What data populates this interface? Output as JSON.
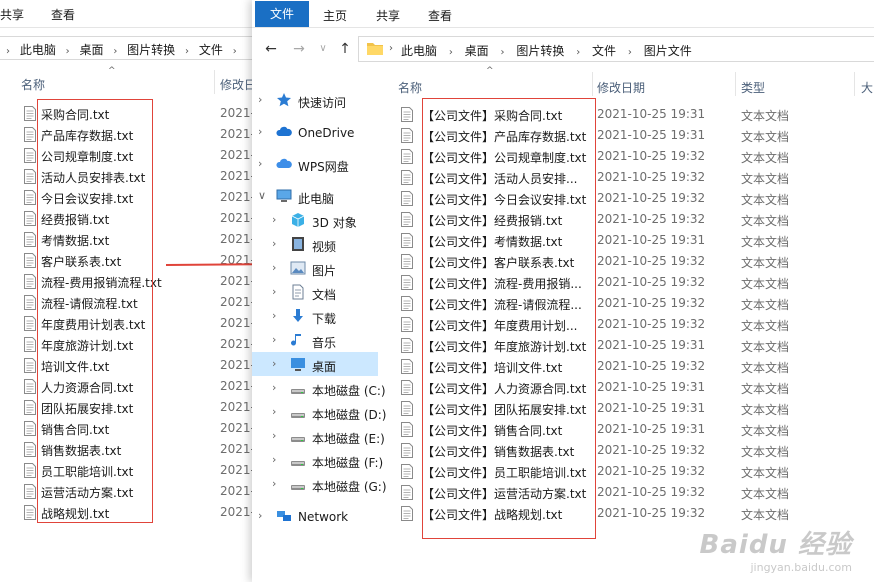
{
  "back_window": {
    "ribbon": {
      "share_label": "共享",
      "view_label": "查看"
    },
    "breadcrumbs": [
      "此电脑",
      "桌面",
      "图片转换",
      "文件"
    ],
    "columns": {
      "name": "名称",
      "modified": "修改日"
    },
    "files": [
      {
        "name": "采购合同.txt",
        "date": "2021-"
      },
      {
        "name": "产品库存数据.txt",
        "date": "2021-"
      },
      {
        "name": "公司规章制度.txt",
        "date": "2021-"
      },
      {
        "name": "活动人员安排表.txt",
        "date": "2021-"
      },
      {
        "name": "今日会议安排.txt",
        "date": "2021-"
      },
      {
        "name": "经费报销.txt",
        "date": "2021-"
      },
      {
        "name": "考情数据.txt",
        "date": "2021-"
      },
      {
        "name": "客户联系表.txt",
        "date": "2021-"
      },
      {
        "name": "流程-费用报销流程.txt",
        "date": "2021-"
      },
      {
        "name": "流程-请假流程.txt",
        "date": "2021-"
      },
      {
        "name": "年度费用计划表.txt",
        "date": "2021-"
      },
      {
        "name": "年度旅游计划.txt",
        "date": "2021-"
      },
      {
        "name": "培训文件.txt",
        "date": "2021-"
      },
      {
        "name": "人力资源合同.txt",
        "date": "2021-"
      },
      {
        "name": "团队拓展安排.txt",
        "date": "2021-"
      },
      {
        "name": "销售合同.txt",
        "date": "2021-"
      },
      {
        "name": "销售数据表.txt",
        "date": "2021-"
      },
      {
        "name": "员工职能培训.txt",
        "date": "2021-"
      },
      {
        "name": "运营活动方案.txt",
        "date": "2021-"
      },
      {
        "name": "战略规划.txt",
        "date": "2021-"
      }
    ]
  },
  "front_window": {
    "ribbon": {
      "file_label": "文件",
      "home_label": "主页",
      "share_label": "共享",
      "view_label": "查看"
    },
    "breadcrumbs": [
      "此电脑",
      "桌面",
      "图片转换",
      "文件",
      "图片文件"
    ],
    "sidebar": [
      {
        "label": "快速访问",
        "icon": "star-icon"
      },
      {
        "label": "OneDrive",
        "icon": "cloud-icon"
      },
      {
        "label": "WPS网盘",
        "icon": "wps-cloud-icon"
      },
      {
        "label": "此电脑",
        "icon": "computer-icon"
      },
      {
        "label": "3D 对象",
        "icon": "cube-icon"
      },
      {
        "label": "视频",
        "icon": "video-icon"
      },
      {
        "label": "图片",
        "icon": "picture-icon"
      },
      {
        "label": "文档",
        "icon": "document-icon"
      },
      {
        "label": "下载",
        "icon": "download-icon"
      },
      {
        "label": "音乐",
        "icon": "music-icon"
      },
      {
        "label": "桌面",
        "icon": "desktop-icon"
      },
      {
        "label": "本地磁盘 (C:)",
        "icon": "drive-icon"
      },
      {
        "label": "本地磁盘 (D:)",
        "icon": "drive-icon"
      },
      {
        "label": "本地磁盘 (E:)",
        "icon": "drive-icon"
      },
      {
        "label": "本地磁盘 (F:)",
        "icon": "drive-icon"
      },
      {
        "label": "本地磁盘 (G:)",
        "icon": "drive-icon"
      },
      {
        "label": "Network",
        "icon": "network-icon"
      }
    ],
    "columns": {
      "name": "名称",
      "modified": "修改日期",
      "type": "类型",
      "size": "大"
    },
    "files": [
      {
        "name": "【公司文件】采购合同.txt",
        "date": "2021-10-25 19:31",
        "type": "文本文档"
      },
      {
        "name": "【公司文件】产品库存数据.txt",
        "date": "2021-10-25 19:31",
        "type": "文本文档"
      },
      {
        "name": "【公司文件】公司规章制度.txt",
        "date": "2021-10-25 19:32",
        "type": "文本文档"
      },
      {
        "name": "【公司文件】活动人员安排...",
        "date": "2021-10-25 19:32",
        "type": "文本文档"
      },
      {
        "name": "【公司文件】今日会议安排.txt",
        "date": "2021-10-25 19:32",
        "type": "文本文档"
      },
      {
        "name": "【公司文件】经费报销.txt",
        "date": "2021-10-25 19:32",
        "type": "文本文档"
      },
      {
        "name": "【公司文件】考情数据.txt",
        "date": "2021-10-25 19:31",
        "type": "文本文档"
      },
      {
        "name": "【公司文件】客户联系表.txt",
        "date": "2021-10-25 19:32",
        "type": "文本文档"
      },
      {
        "name": "【公司文件】流程-费用报销...",
        "date": "2021-10-25 19:32",
        "type": "文本文档"
      },
      {
        "name": "【公司文件】流程-请假流程...",
        "date": "2021-10-25 19:32",
        "type": "文本文档"
      },
      {
        "name": "【公司文件】年度费用计划...",
        "date": "2021-10-25 19:32",
        "type": "文本文档"
      },
      {
        "name": "【公司文件】年度旅游计划.txt",
        "date": "2021-10-25 19:31",
        "type": "文本文档"
      },
      {
        "name": "【公司文件】培训文件.txt",
        "date": "2021-10-25 19:32",
        "type": "文本文档"
      },
      {
        "name": "【公司文件】人力资源合同.txt",
        "date": "2021-10-25 19:31",
        "type": "文本文档"
      },
      {
        "name": "【公司文件】团队拓展安排.txt",
        "date": "2021-10-25 19:31",
        "type": "文本文档"
      },
      {
        "name": "【公司文件】销售合同.txt",
        "date": "2021-10-25 19:31",
        "type": "文本文档"
      },
      {
        "name": "【公司文件】销售数据表.txt",
        "date": "2021-10-25 19:32",
        "type": "文本文档"
      },
      {
        "name": "【公司文件】员工职能培训.txt",
        "date": "2021-10-25 19:32",
        "type": "文本文档"
      },
      {
        "name": "【公司文件】运营活动方案.txt",
        "date": "2021-10-25 19:32",
        "type": "文本文档"
      },
      {
        "name": "【公司文件】战略规划.txt",
        "date": "2021-10-25 19:32",
        "type": "文本文档"
      }
    ]
  },
  "watermark": {
    "line1": "Baidu 经验",
    "line2": "jingyan.baidu.com"
  },
  "colors": {
    "accent": "#1a6fc4",
    "highlight": "#e0443a",
    "selected_bg": "#cce8ff"
  }
}
